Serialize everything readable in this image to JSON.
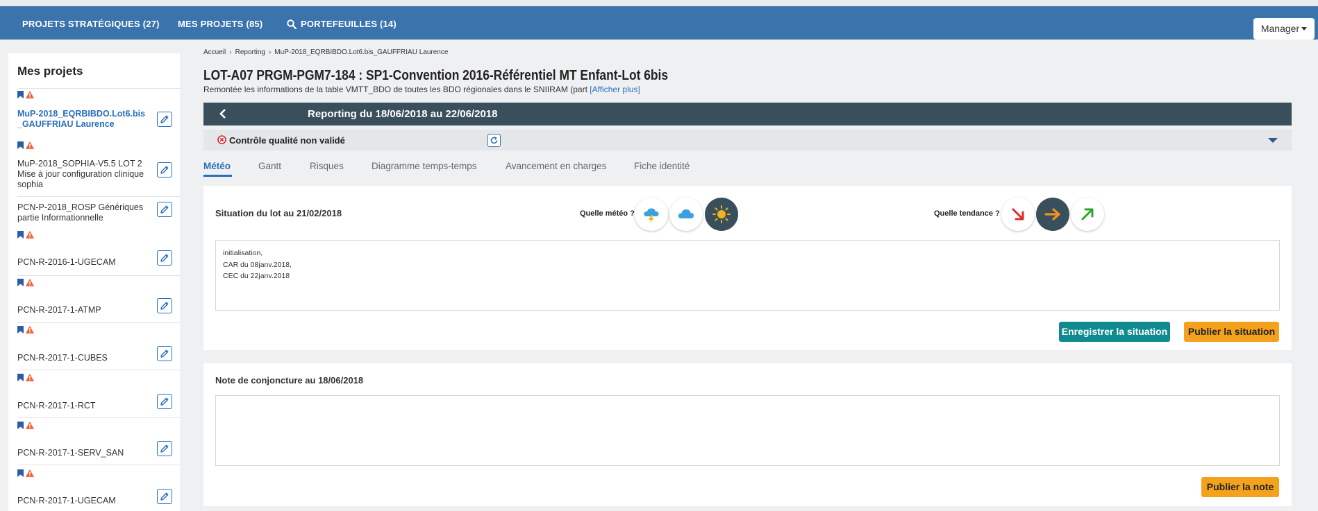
{
  "nav": {
    "items": [
      "PROJETS STRATÉGIQUES (27)",
      "MES PROJETS (85)",
      "PORTEFEUILLES (14)"
    ],
    "manager_label": "Manager"
  },
  "sidebar": {
    "title": "Mes projets",
    "items": [
      {
        "label": "MuP-2018_EQRBIBDO.Lot6.bis_GAUFFRIAU Laurence",
        "active": true
      },
      {
        "label": "MuP-2018_SOPHIA-V5.5 LOT 2 Mise à jour configuration clinique sophia",
        "active": false
      },
      {
        "label": "PCN-P-2018_ROSP Génériques partie Informationnelle",
        "active": false
      },
      {
        "label": "PCN-R-2016-1-UGECAM",
        "active": false
      },
      {
        "label": "PCN-R-2017-1-ATMP",
        "active": false
      },
      {
        "label": "PCN-R-2017-1-CUBES",
        "active": false
      },
      {
        "label": "PCN-R-2017-1-RCT",
        "active": false
      },
      {
        "label": "PCN-R-2017-1-SERV_SAN",
        "active": false
      },
      {
        "label": "PCN-R-2017-1-UGECAM",
        "active": false
      }
    ]
  },
  "breadcrumb": [
    "Accueil",
    "Reporting",
    "MuP-2018_EQRBIBDO.Lot6.bis_GAUFFRIAU Laurence"
  ],
  "page": {
    "title": "LOT-A07 PRGM-PGM7-184 : SP1-Convention 2016-Référentiel MT Enfant-Lot 6bis",
    "subtitle": "Remontée les informations de la table VMTT_BDO de toutes les BDO régionales dans le SNIIRAM (part",
    "show_more": "[Afficher plus]"
  },
  "reporting": {
    "title": "Reporting du 18/06/2018 au 22/06/2018",
    "quality_status": "Contrôle qualité non validé"
  },
  "tabs": [
    "Météo",
    "Gantt",
    "Risques",
    "Diagramme temps-temps",
    "Avancement en charges",
    "Fiche identité"
  ],
  "active_tab": "Météo",
  "situation": {
    "label": "Situation du lot au 21/02/2018",
    "weather_question": "Quelle météo ?",
    "weather_options": [
      "storm-icon",
      "cloud-icon",
      "sun-icon"
    ],
    "weather_selected": "sun-icon",
    "trend_question": "Quelle tendance ?",
    "trend_options": [
      "arrow-down-right-icon",
      "arrow-right-icon",
      "arrow-up-right-icon"
    ],
    "trend_selected": "arrow-right-icon",
    "text_lines": [
      "initialisation,",
      "CAR du 08janv.2018,",
      "CEC du 22janv.2018"
    ],
    "save_label": "Enregistrer la situation",
    "publish_label": "Publier la situation"
  },
  "note": {
    "label": "Note de conjoncture au 18/06/2018",
    "text": "",
    "publish_label": "Publier la note"
  },
  "colors": {
    "navbar": "#3b74ad",
    "report_bar": "#3a4f5c",
    "accent": "#2a6ebd",
    "teal_button": "#0f8a8e",
    "orange_button": "#f4a21c",
    "warning": "#e8663a"
  }
}
